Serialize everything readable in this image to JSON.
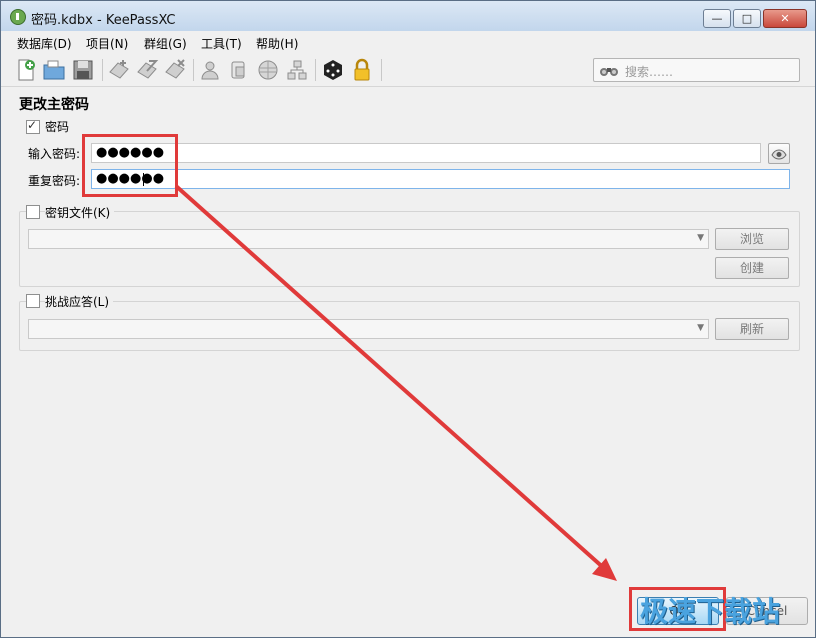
{
  "window": {
    "title": "密码.kdbx - KeePassXC",
    "minimize_glyph": "—",
    "maximize_glyph": "□",
    "close_glyph": "✕"
  },
  "menu": [
    {
      "label": "数据库(D)"
    },
    {
      "label": "项目(N)"
    },
    {
      "label": "群组(G)"
    },
    {
      "label": "工具(T)"
    },
    {
      "label": "帮助(H)"
    }
  ],
  "toolbar_icons": [
    "new-database-icon",
    "open-database-icon",
    "save-database-icon",
    "add-entry-icon",
    "edit-entry-icon",
    "delete-entry-icon",
    "copy-username-icon",
    "copy-password-icon",
    "open-url-icon",
    "clone-entry-icon",
    "password-generator-icon",
    "lock-database-icon"
  ],
  "search": {
    "placeholder": "搜索……",
    "icon": "binoculars-icon"
  },
  "dialog": {
    "heading": "更改主密码",
    "password_section": {
      "checkbox_label": "密码",
      "checked": true,
      "enter_label": "输入密码:",
      "enter_value": "●●●●●●",
      "repeat_label": "重复密码:",
      "repeat_value": "●●●●●●",
      "reveal_icon": "eye-icon"
    },
    "keyfile_section": {
      "checkbox_label": "密钥文件(K)",
      "checked": false,
      "combo_value": "",
      "browse_label": "浏览",
      "create_label": "创建"
    },
    "challenge_section": {
      "checkbox_label": "挑战应答(L)",
      "checked": false,
      "combo_value": "",
      "refresh_label": "刷新"
    },
    "ok_label": "OK",
    "cancel_label": "Cancel"
  },
  "annotation": {
    "color": "#e03a3a"
  },
  "watermark": {
    "text": "极速下载站"
  }
}
